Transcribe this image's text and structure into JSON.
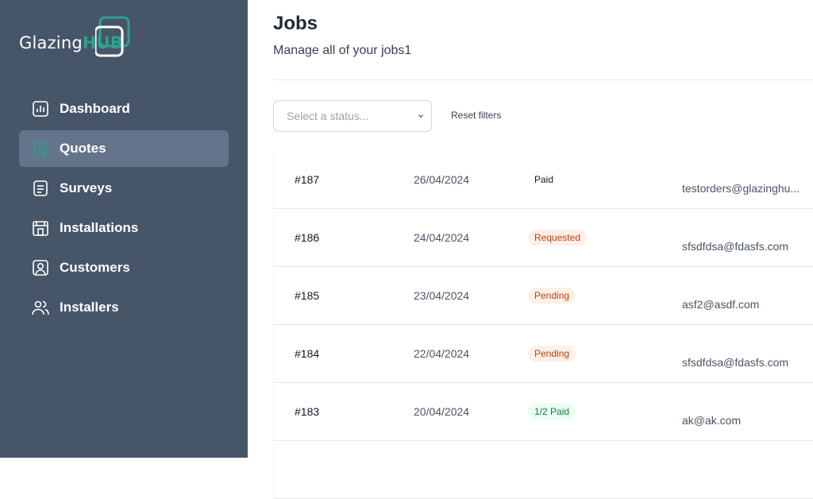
{
  "brand": {
    "name_part1": "Glazing",
    "name_part2": "HUB"
  },
  "sidebar": {
    "items": [
      {
        "label": "Dashboard",
        "icon": "dashboard-chart-icon",
        "active": false
      },
      {
        "label": "Quotes",
        "icon": "quote-document-icon",
        "active": true
      },
      {
        "label": "Surveys",
        "icon": "survey-document-icon",
        "active": false
      },
      {
        "label": "Installations",
        "icon": "installation-building-icon",
        "active": false
      },
      {
        "label": "Customers",
        "icon": "customer-user-icon",
        "active": false
      },
      {
        "label": "Installers",
        "icon": "installers-users-icon",
        "active": false
      }
    ]
  },
  "header": {
    "title": "Jobs",
    "subtitle": "Manage all of your jobs1"
  },
  "filters": {
    "status_placeholder": "Select a status...",
    "reset_label": "Reset filters"
  },
  "colors": {
    "sidebar_bg": "#475569",
    "active_item_bg": "#64748b",
    "brand_accent": "#2fa08e"
  },
  "jobs": [
    {
      "id": "#187",
      "date": "26/04/2024",
      "status": "Paid",
      "status_type": "paid",
      "email": "testorders@glazinghu..."
    },
    {
      "id": "#186",
      "date": "24/04/2024",
      "status": "Requested",
      "status_type": "requested",
      "email": "sfsdfdsa@fdasfs.com"
    },
    {
      "id": "#185",
      "date": "23/04/2024",
      "status": "Pending",
      "status_type": "pending",
      "email": "asf2@asdf.com"
    },
    {
      "id": "#184",
      "date": "22/04/2024",
      "status": "Pending",
      "status_type": "pending",
      "email": "sfsdfdsa@fdasfs.com"
    },
    {
      "id": "#183",
      "date": "20/04/2024",
      "status": "1/2 Paid",
      "status_type": "half-paid",
      "email": "ak@ak.com"
    }
  ]
}
